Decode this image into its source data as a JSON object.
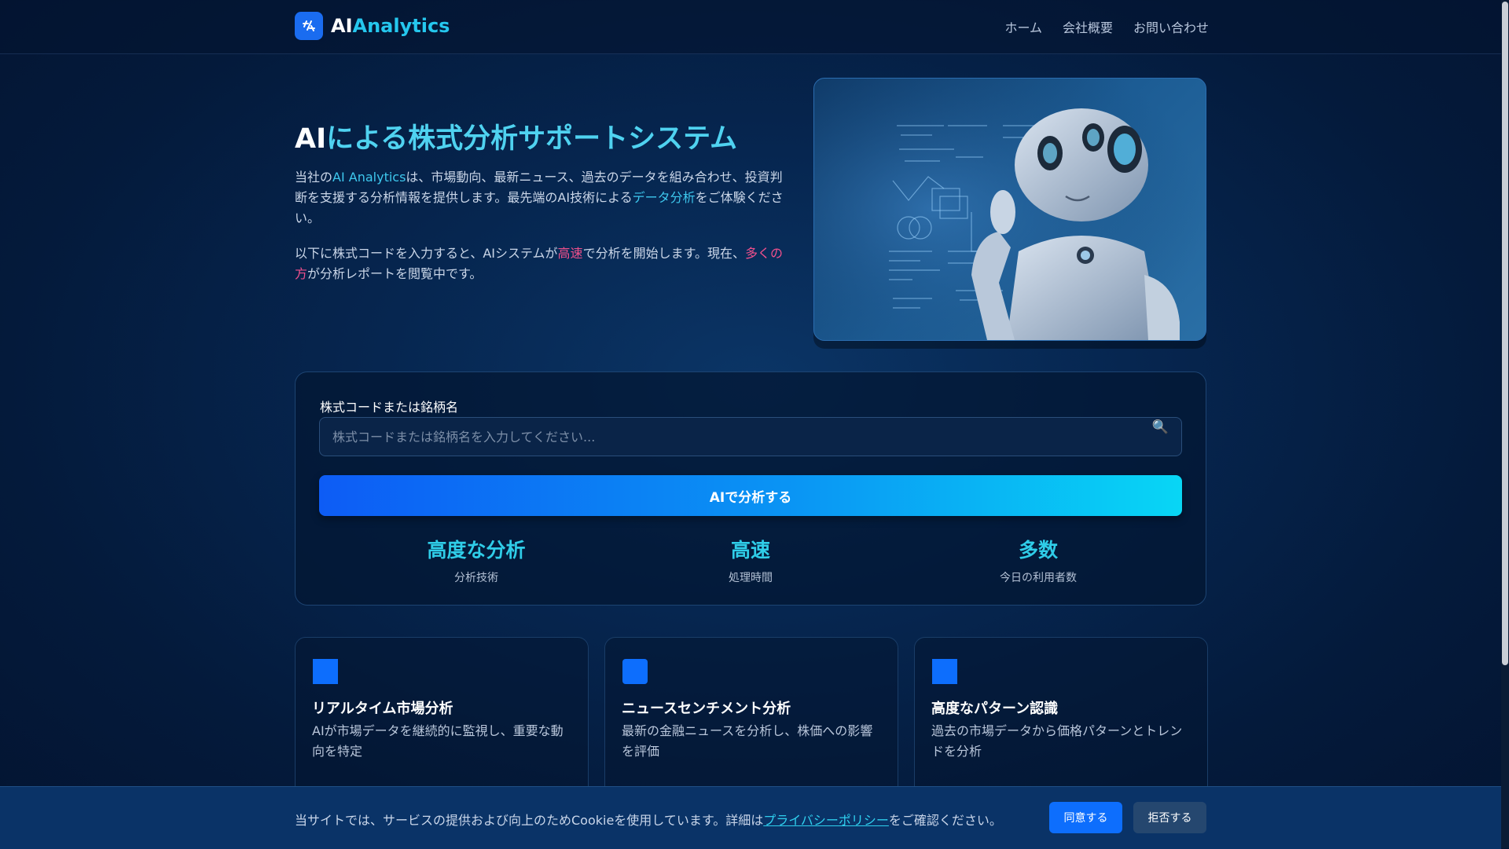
{
  "header": {
    "brand_ai": "AI",
    "brand_analytics": "Analytics",
    "nav": [
      "ホーム",
      "会社概要",
      "お問い合わせ"
    ]
  },
  "hero": {
    "title_ai": "AI",
    "title_rest": "による株式分析サポートシステム",
    "p1_a": "当社の",
    "p1_brand": "AI Analytics",
    "p1_b": "は、市場動向、最新ニュース、過去のデータを組み合わせ、投資判断を支援する分析情報を提供します。最先端のAI技術による",
    "p1_hl": "データ分析",
    "p1_c": "をご体験ください。",
    "p2_a": "以下に株式コードを入力すると、AIシステムが",
    "p2_hl1": "高速",
    "p2_b": "で分析を開始します。現在、",
    "p2_hl2": "多くの方",
    "p2_c": "が分析レポートを閲覧中です。"
  },
  "search": {
    "label": "株式コードまたは銘柄名",
    "placeholder": "株式コードまたは銘柄名を入力してください...",
    "button_label": "AIで分析する"
  },
  "stats": [
    {
      "value": "高度な分析",
      "label": "分析技術"
    },
    {
      "value": "高速",
      "label": "処理時間"
    },
    {
      "value": "多数",
      "label": "今日の利用者数"
    }
  ],
  "features": [
    {
      "title": "リアルタイム市場分析",
      "desc": "AIが市場データを継続的に監視し、重要な動向を特定"
    },
    {
      "title": "ニュースセンチメント分析",
      "desc": "最新の金融ニュースを分析し、株価への影響を評価"
    },
    {
      "title": "高度なパターン認識",
      "desc": "過去の市場データから価格パターンとトレンドを分析"
    }
  ],
  "cookie": {
    "text_a": "当サイトでは、サービスの提供および向上のためCookieを使用しています。詳細は",
    "link": "プライバシーポリシー",
    "text_b": "をご確認ください。",
    "accept": "同意する",
    "reject": "拒否する"
  },
  "colors": {
    "accent": "#0d6efd",
    "cyan": "#2fcde8",
    "pink": "#f0508c",
    "background": "#062650"
  }
}
